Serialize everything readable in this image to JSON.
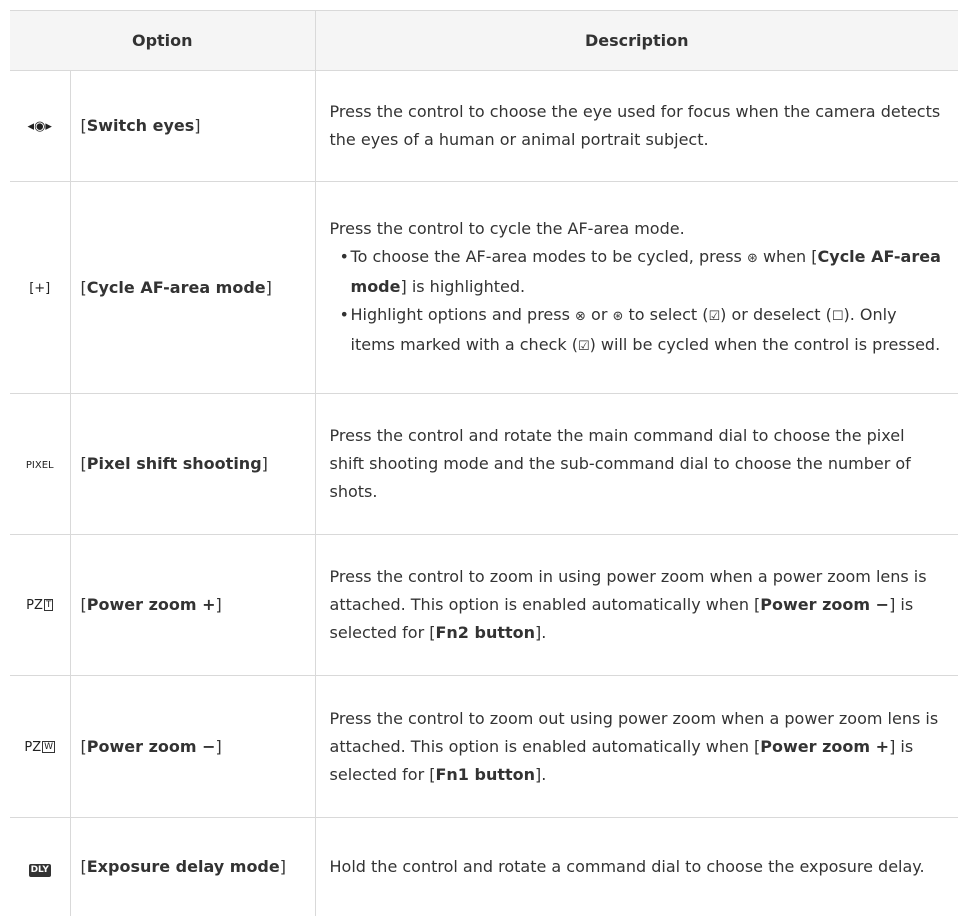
{
  "header": {
    "option": "Option",
    "description": "Description"
  },
  "rows": [
    {
      "icon": "switch-eyes-icon",
      "icon_text": "◂◉▸",
      "name": "Switch eyes",
      "desc": "Press the control to choose the eye used for focus when the camera detects the eyes of a human or animal portrait subject."
    },
    {
      "icon": "cycle-af-area-icon",
      "icon_text": "[+]",
      "name": "Cycle AF-area mode",
      "desc_intro": "Press the control to cycle the AF-area mode.",
      "bullet1_a": "To choose the AF-area modes to be cycled, press",
      "sym_right": "⊛",
      "bullet1_b": "when [",
      "bullet1_bold": "Cycle AF-area mode",
      "bullet1_c": "] is highlighted.",
      "bullet2_a": "Highlight options and press",
      "sym_ok": "⊗",
      "bullet2_b": "or",
      "bullet2_c": "to select (",
      "sym_checked": "☑",
      "bullet2_d": ") or deselect (",
      "sym_unchecked": "☐",
      "bullet2_e": "). Only items marked with a check (",
      "bullet2_f": ") will be cycled when the control is pressed."
    },
    {
      "icon": "pixel-shift-icon",
      "icon_text": "PIXEL",
      "name": "Pixel shift shooting",
      "desc": "Press the control and rotate the main command dial to choose the pixel shift shooting mode and the sub-command dial to choose the number of shots."
    },
    {
      "icon": "power-zoom-plus-icon",
      "icon_text": "PZ",
      "icon_box": "T",
      "name": "Power zoom +",
      "desc_a": "Press the control to zoom in using power zoom when a power zoom lens is attached. This option is enabled automatically when [",
      "desc_bold1": "Power zoom −",
      "desc_b": "] is selected for [",
      "desc_bold2": "Fn2 button",
      "desc_c": "]."
    },
    {
      "icon": "power-zoom-minus-icon",
      "icon_text": "PZ",
      "icon_box": "W",
      "name": "Power zoom −",
      "desc_a": "Press the control to zoom out using power zoom when a power zoom lens is attached. This option is enabled automatically when [",
      "desc_bold1": "Power zoom +",
      "desc_b": "] is selected for [",
      "desc_bold2": "Fn1 button",
      "desc_c": "]."
    },
    {
      "icon": "exposure-delay-icon",
      "icon_text": "DLY",
      "name": "Exposure delay mode",
      "desc": "Hold the control and rotate a command dial to choose the exposure delay."
    }
  ]
}
